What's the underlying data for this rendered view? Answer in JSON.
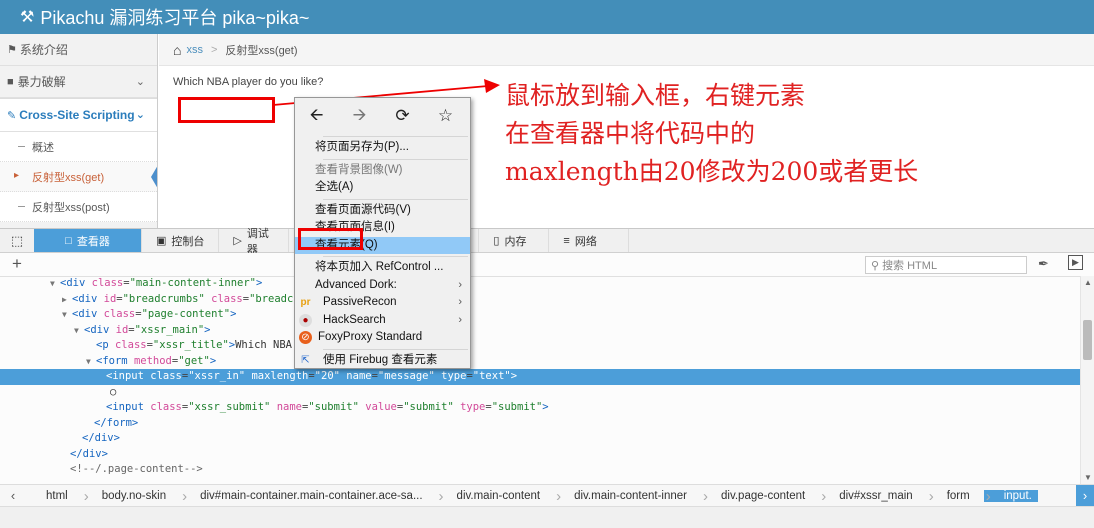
{
  "app": {
    "title": "Pikachu 漏洞练习平台 pika~pika~"
  },
  "sidebar": {
    "items": [
      {
        "label": "系统介绍"
      },
      {
        "label": "暴力破解"
      },
      {
        "label": "Cross-Site Scripting"
      }
    ],
    "subitems": [
      {
        "label": "概述"
      },
      {
        "label": "反射型xss(get)"
      },
      {
        "label": "反射型xss(post)"
      }
    ]
  },
  "breadcrumbs": {
    "link": "xss",
    "current": "反射型xss(get)"
  },
  "main": {
    "question": "Which NBA player do you like?",
    "input_value": ""
  },
  "annotation": {
    "text": "鼠标放到输入框，右键元素\n在查看器中将代码中的\nmaxlength由20修改为200或者更长",
    "color": "#e02222"
  },
  "context_menu": {
    "items": [
      {
        "label": "将页面另存为(P)...",
        "disabled": false
      },
      {
        "label": "查看背景图像(W)",
        "disabled": true
      },
      {
        "label": "全选(A)",
        "disabled": false
      },
      {
        "label": "查看页面源代码(V)",
        "disabled": false
      },
      {
        "label": "查看页面信息(I)",
        "disabled": false
      },
      {
        "label": "查看元素(Q)",
        "disabled": false
      },
      {
        "label": "将本页加入 RefControl ...",
        "disabled": false
      },
      {
        "label": "Advanced Dork:",
        "disabled": false
      },
      {
        "label": "PassiveRecon",
        "disabled": false
      },
      {
        "label": "HackSearch",
        "disabled": false
      },
      {
        "label": "FoxyProxy Standard",
        "disabled": false
      },
      {
        "label": "使用 Firebug 查看元素",
        "disabled": false
      }
    ]
  },
  "devtools": {
    "tabs": [
      {
        "label": "查看器",
        "icon": "inspector-icon"
      },
      {
        "label": "控制台",
        "icon": "console-icon"
      },
      {
        "label": "调试器",
        "icon": "debugger-icon"
      },
      {
        "label": "内存",
        "icon": "memory-icon"
      },
      {
        "label": "网络",
        "icon": "network-icon"
      }
    ],
    "search_placeholder": "搜索 HTML",
    "breadcrumbs": [
      "html",
      "body.no-skin",
      "div#main-container.main-container.ace-sa...",
      "div.main-content",
      "div.main-content-inner",
      "div.page-content",
      "div#xssr_main",
      "form",
      "input."
    ],
    "accent": "#4c9ed9"
  },
  "markup": {
    "line1_tag": "<div",
    "line1_attr": "class",
    "line1_val": "\"main-content-inner\"",
    "line2_tag": "<div",
    "line2_attr": "id",
    "line2_val": "\"breadcrumbs\"",
    "line2_attr2": "class",
    "line2_val2": "\"breadcrum",
    "line3_tag": "<div",
    "line3_attr": "class",
    "line3_val": "\"page-content\"",
    "line4_tag": "<div",
    "line4_attr": "id",
    "line4_val": "\"xssr_main\"",
    "line5_tag": "<p",
    "line5_attr": "class",
    "line5_val": "\"xssr_title\"",
    "line5_text": "Which NBA pl",
    "line6_tag": "<form",
    "line6_attr": "method",
    "line6_val": "\"get\"",
    "line7_tag": "<input",
    "line7_a1": "class",
    "line7_v1": "\"xssr_in\"",
    "line7_a2": "maxlength",
    "line7_v2": "\"20\"",
    "line7_a3": "name",
    "line7_v3": "\"message\"",
    "line7_a4": "type",
    "line7_v4": "\"text\"",
    "line8_text": "○",
    "line9_tag": "<input",
    "line9_a1": "class",
    "line9_v1": "\"xssr_submit\"",
    "line9_a2": "name",
    "line9_v2": "\"submit\"",
    "line9_a3": "value",
    "line9_v3": "\"submit\"",
    "line9_a4": "type",
    "line9_v4": "\"submit\"",
    "line10_tag": "</form>",
    "line11_tag": "</div>",
    "line12_tag": "</div>",
    "line13_comment": "<!--/.page-content-->"
  }
}
